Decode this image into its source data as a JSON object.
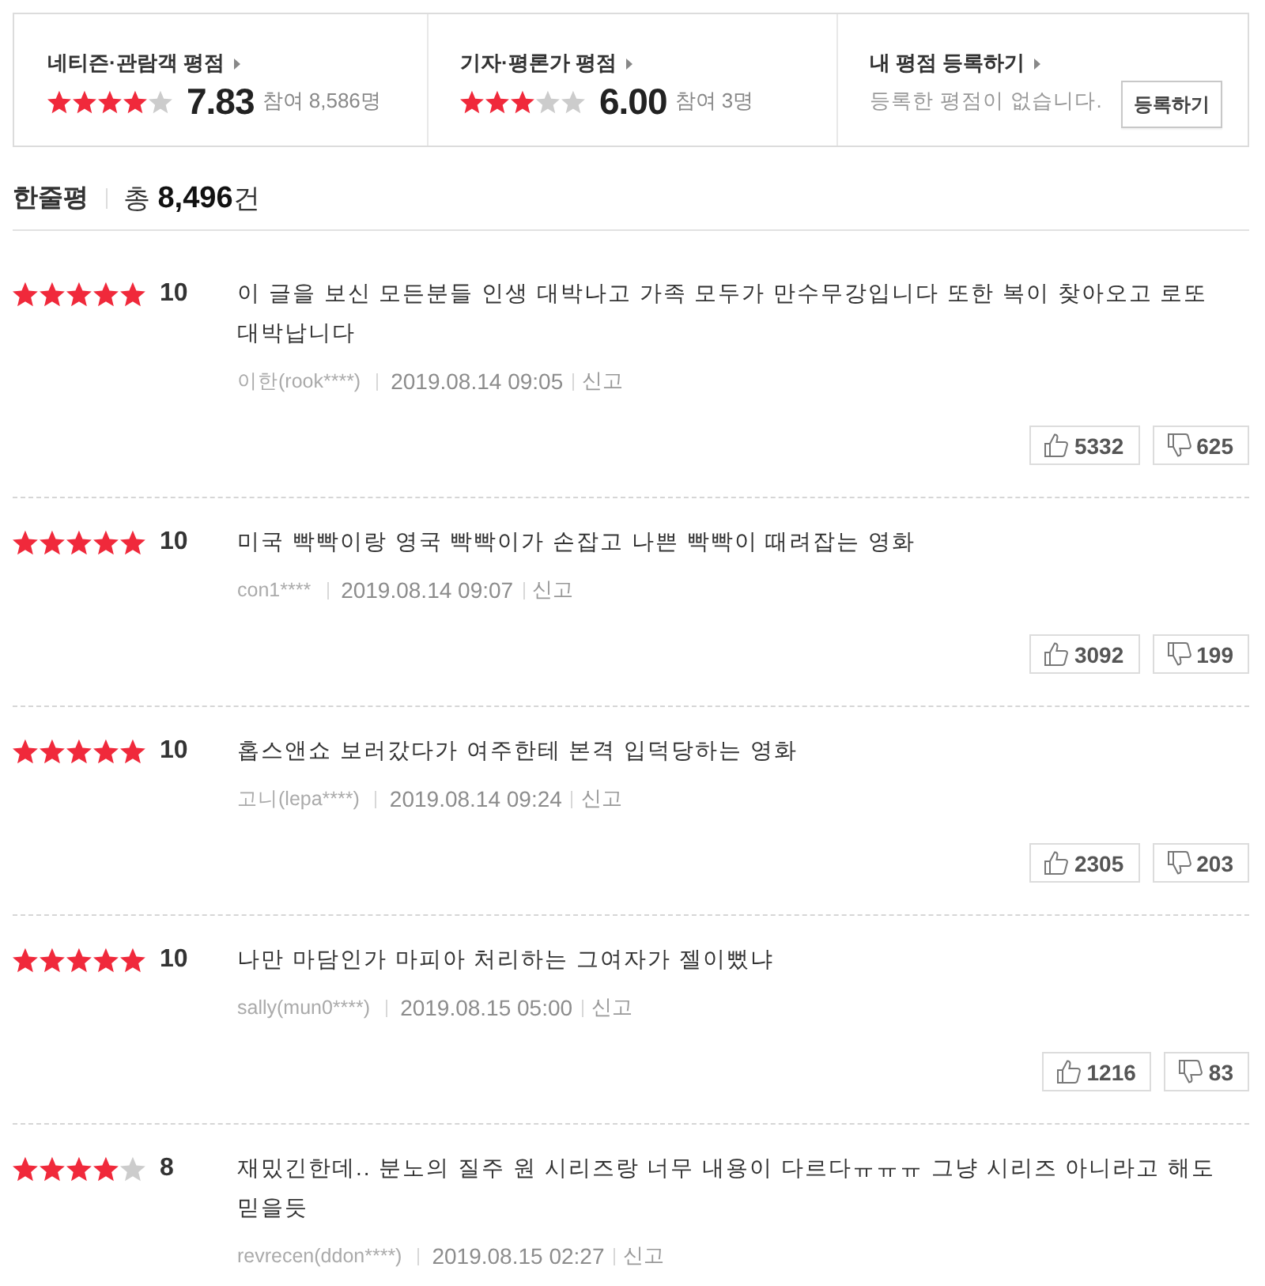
{
  "ratings": [
    {
      "title": "네티즌·관람객 평점",
      "stars": 4,
      "score": "7.83",
      "participants": "참여 8,586명"
    },
    {
      "title": "기자·평론가 평점",
      "stars": 3,
      "score": "6.00",
      "participants": "참여 3명"
    }
  ],
  "my_rating": {
    "title": "내 평점 등록하기",
    "message": "등록한 평점이 없습니다.",
    "button": "등록하기"
  },
  "section": {
    "title": "한줄평",
    "count": "총 **8,496**건"
  },
  "reviews": [
    {
      "stars": 5,
      "score": "10",
      "text": "이 글을 보신 모든분들 인생 대박나고 가족 모두가 만수무강입니다 또한 복이 찾아오고 로또 대박납니다",
      "author": "이한(rook****)",
      "date": "2019.08.14 09:05",
      "report": "신고",
      "likes": "5332",
      "dislikes": "625"
    },
    {
      "stars": 5,
      "score": "10",
      "text": "미국 빡빡이랑 영국 빡빡이가 손잡고 나쁜 빡빡이 때려잡는 영화",
      "author": "con1****",
      "date": "2019.08.14 09:07",
      "report": "신고",
      "likes": "3092",
      "dislikes": "199"
    },
    {
      "stars": 5,
      "score": "10",
      "text": "홉스앤쇼 보러갔다가 여주한테 본격 입덕당하는 영화",
      "author": "고니(lepa****)",
      "date": "2019.08.14 09:24",
      "report": "신고",
      "likes": "2305",
      "dislikes": "203"
    },
    {
      "stars": 5,
      "score": "10",
      "text": "나만 마담인가 마피아 처리하는 그여자가 젤이뻤냐",
      "author": "sally(mun0****)",
      "date": "2019.08.15 05:00",
      "report": "신고",
      "likes": "1216",
      "dislikes": "83"
    },
    {
      "stars": 4,
      "score": "8",
      "text": "재밌긴한데.. 분노의 질주 원 시리즈랑 너무 내용이 다르다ㅠㅠㅠ 그냥 시리즈 아니라고 해도 믿을듯",
      "author": "revrecen(ddon****)",
      "date": "2019.08.15 02:27",
      "report": "신고"
    }
  ]
}
